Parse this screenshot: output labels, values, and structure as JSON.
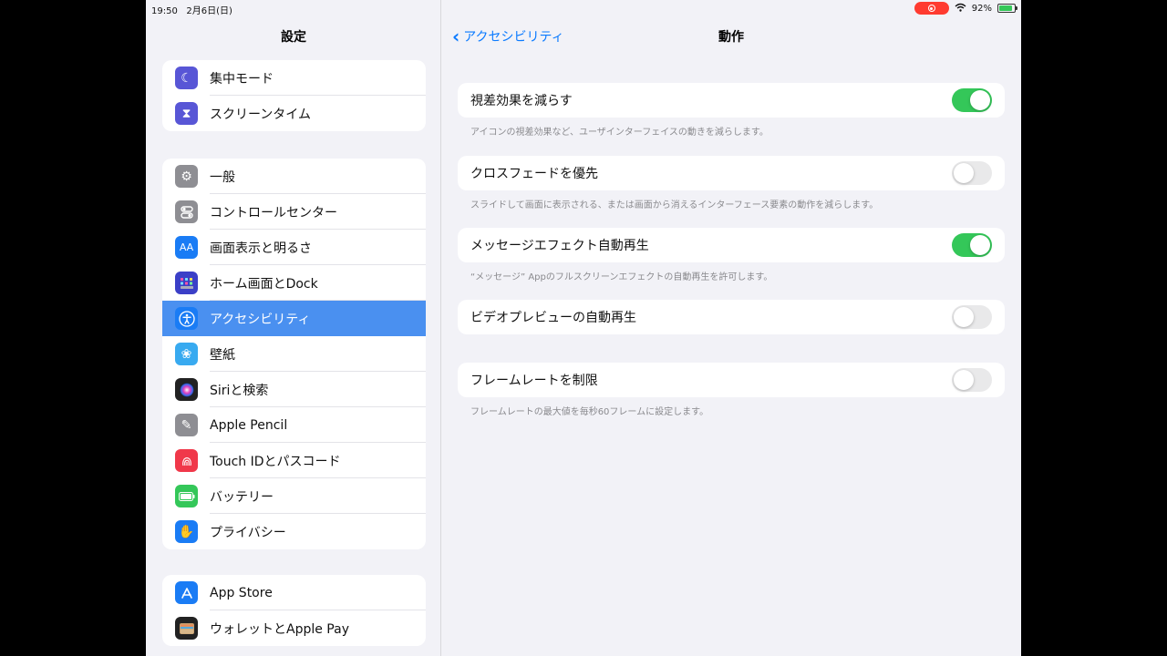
{
  "status": {
    "time": "19:50",
    "date": "2月6日(日)",
    "battery": "92%"
  },
  "sidebar": {
    "title": "設定",
    "groups": [
      [
        {
          "label": "集中モード",
          "icon": "moon-icon",
          "color": "#5856d6"
        },
        {
          "label": "スクリーンタイム",
          "icon": "hourglass-icon",
          "color": "#5856d6"
        }
      ],
      [
        {
          "label": "一般",
          "icon": "gear-icon",
          "color": "#8e8e93"
        },
        {
          "label": "コントロールセンター",
          "icon": "toggles-icon",
          "color": "#8e8e93"
        },
        {
          "label": "画面表示と明るさ",
          "icon": "text-size-icon",
          "color": "#1a7cf5"
        },
        {
          "label": "ホーム画面とDock",
          "icon": "home-grid-icon",
          "color": "#3b3fc7"
        },
        {
          "label": "アクセシビリティ",
          "icon": "accessibility-icon",
          "color": "#1a7cf5",
          "selected": true
        },
        {
          "label": "壁紙",
          "icon": "flower-icon",
          "color": "#38aaf0"
        },
        {
          "label": "Siriと検索",
          "icon": "siri-icon",
          "color": "#222"
        },
        {
          "label": "Apple Pencil",
          "icon": "pencil-icon",
          "color": "#8e8e93"
        },
        {
          "label": "Touch IDとパスコード",
          "icon": "fingerprint-icon",
          "color": "#f0384a"
        },
        {
          "label": "バッテリー",
          "icon": "battery-icon",
          "color": "#34c759"
        },
        {
          "label": "プライバシー",
          "icon": "hand-icon",
          "color": "#1a7cf5"
        }
      ],
      [
        {
          "label": "App Store",
          "icon": "app-store-icon",
          "color": "#1a7cf5"
        },
        {
          "label": "ウォレットとApple Pay",
          "icon": "wallet-icon",
          "color": "#222"
        }
      ]
    ]
  },
  "detail": {
    "back_label": "アクセシビリティ",
    "title": "動作",
    "settings": [
      {
        "label": "視差効果を減らす",
        "on": true,
        "footer": "アイコンの視差効果など、ユーザインターフェイスの動きを減らします。"
      },
      {
        "label": "クロスフェードを優先",
        "on": false,
        "footer": "スライドして画面に表示される、または画面から消えるインターフェース要素の動作を減らします。"
      },
      {
        "label": "メッセージエフェクト自動再生",
        "on": true,
        "footer": "“メッセージ” Appのフルスクリーンエフェクトの自動再生を許可します。"
      },
      {
        "label": "ビデオプレビューの自動再生",
        "on": false,
        "footer": ""
      },
      {
        "label": "フレームレートを制限",
        "on": false,
        "footer": "フレームレートの最大値を毎秒60フレームに設定します。"
      }
    ]
  }
}
